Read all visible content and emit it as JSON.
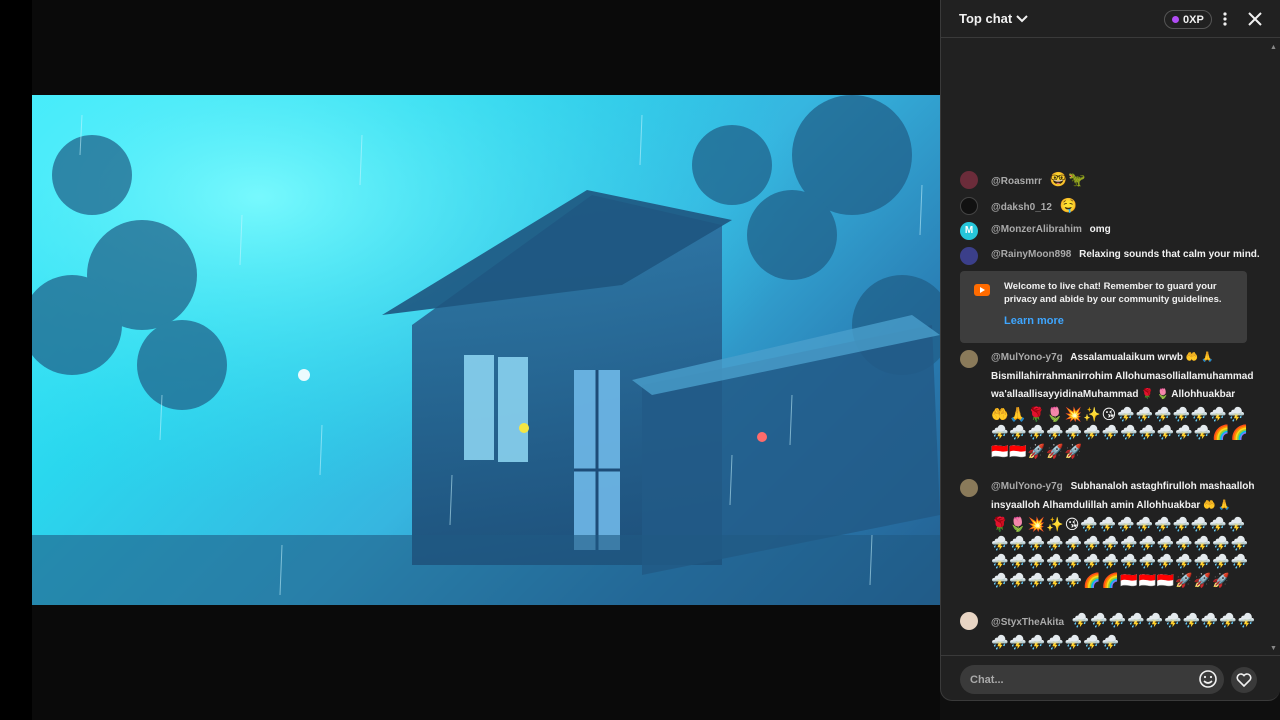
{
  "chat_header": {
    "title": "Top chat",
    "xp_label": "0XP"
  },
  "chat_input": {
    "placeholder": "Chat..."
  },
  "welcome": {
    "text": "Welcome to live chat! Remember to guard your privacy and abide by our community guidelines.",
    "link": "Learn more"
  },
  "messages": [
    {
      "author": "@Roasmrr",
      "text": "🤓🦖"
    },
    {
      "author": "@daksh0_12",
      "text": "🤤"
    },
    {
      "author": "@MonzerAlibrahim",
      "text": "omg",
      "avatar_letter": "M"
    },
    {
      "author": "@RainyMoon898",
      "text": "Relaxing sounds that calm your mind."
    },
    {
      "author": "@MulYono-y7g",
      "text": "Assalamualaikum wrwb 🤲 🙏 Bismillahirrahmanirrohim Allohumasolliallamuhammad wa'allaallisayyidinaMuhammad 🌹 🌷 Allohhuakbar",
      "emojis": "🤲🙏🌹🌷💥✨😘⛈️⛈️⛈️⛈️⛈️⛈️⛈️⛈️⛈️⛈️⛈️⛈️⛈️⛈️⛈️⛈️⛈️⛈️⛈️🌈🌈🇮🇩🇮🇩🚀🚀🚀"
    },
    {
      "author": "@MulYono-y7g",
      "text": "Subhanaloh astaghfirulloh mashaalloh insyaalloh Alhamdulillah amin Allohhuakbar 🤲 🙏",
      "emojis": "🌹🌷💥✨😘⛈️⛈️⛈️⛈️⛈️⛈️⛈️⛈️⛈️⛈️⛈️⛈️⛈️⛈️⛈️⛈️⛈️⛈️⛈️⛈️⛈️⛈️⛈️⛈️⛈️⛈️⛈️⛈️⛈️⛈️⛈️⛈️⛈️⛈️⛈️⛈️⛈️⛈️⛈️⛈️⛈️⛈️🌈🌈🇮🇩🇮🇩🇮🇩🚀🚀🚀"
    },
    {
      "author": "@StyxTheAkita",
      "text": "",
      "emojis": "⛈️⛈️⛈️⛈️⛈️⛈️⛈️⛈️⛈️⛈️⛈️⛈️⛈️⛈️⛈️⛈️⛈️"
    }
  ],
  "colors": {
    "chat_bg": "#212121",
    "accent_link": "#3ea6ff",
    "xp_dot": "#b14cf5",
    "yt_badge": "#ff6b00"
  }
}
